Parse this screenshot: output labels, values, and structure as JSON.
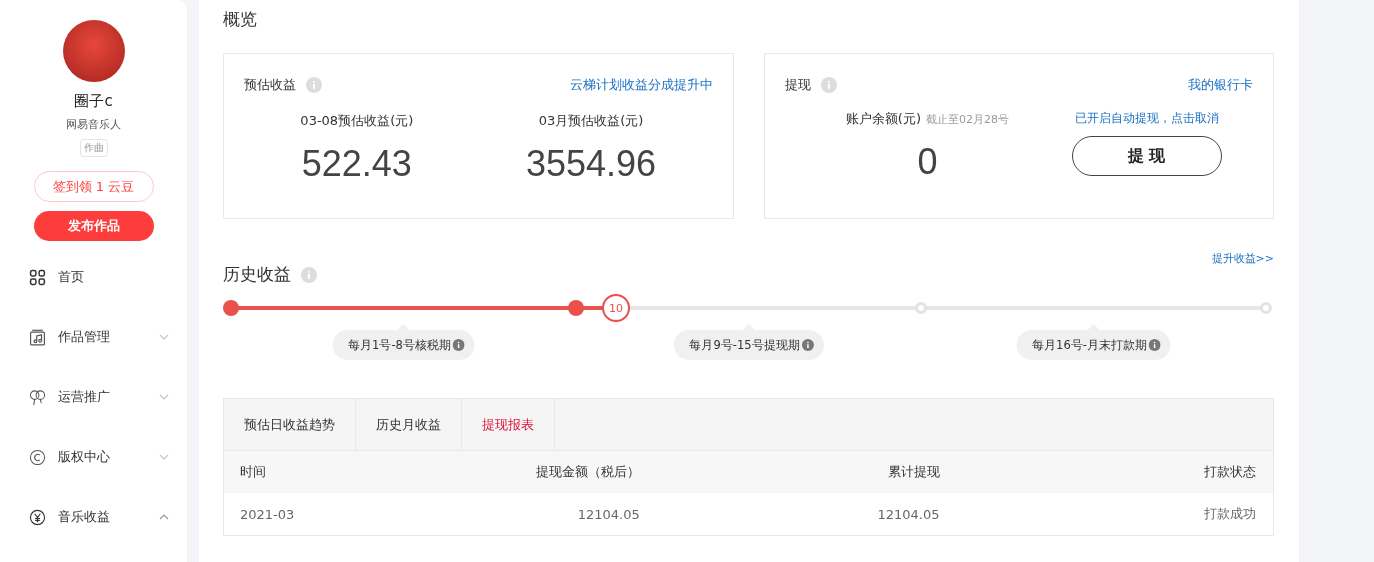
{
  "profile": {
    "name": "圈子c",
    "role": "网易音乐人",
    "tag": "作曲"
  },
  "sidebar": {
    "checkin_button": "签到领 1 云豆",
    "publish_button": "发布作品",
    "items": [
      {
        "label": "首页",
        "kind": "plain"
      },
      {
        "label": "作品管理",
        "kind": "group",
        "expanded": false
      },
      {
        "label": "运营推广",
        "kind": "group",
        "expanded": false
      },
      {
        "label": "版权中心",
        "kind": "group",
        "expanded": false
      },
      {
        "label": "音乐收益",
        "kind": "group",
        "expanded": true
      }
    ]
  },
  "overview": {
    "title": "概览",
    "earnings": {
      "title": "预估收益",
      "link": "云梯计划收益分成提升中",
      "stats": [
        {
          "label": "03-08预估收益(元)",
          "value": "522.43"
        },
        {
          "label": "03月预估收益(元)",
          "value": "3554.96"
        }
      ]
    },
    "withdraw": {
      "title": "提现",
      "link": "我的银行卡",
      "balance_label": "账户余额(元)",
      "balance_note": "截止至02月28号",
      "balance": "0",
      "auto_note": "已开启自动提现，点击取消",
      "button": "提 现"
    }
  },
  "history": {
    "title": "历史收益",
    "link": "提升收益>>",
    "timeline": {
      "level": 0.372,
      "marker": "10",
      "nodes": [
        {
          "reached": true
        },
        {
          "reached": true
        },
        {
          "reached": false
        },
        {
          "reached": false
        }
      ],
      "periods": [
        "每月1号-8号核税期",
        "每月9号-15号提现期",
        "每月16号-月末打款期"
      ]
    }
  },
  "tabs": [
    {
      "label": "预估日收益趋势",
      "selected": false
    },
    {
      "label": "历史月收益",
      "selected": false
    },
    {
      "label": "提现报表",
      "selected": true
    }
  ],
  "table": {
    "columns": [
      "时间",
      "提现金额（税后）",
      "累计提现",
      "打款状态"
    ],
    "rows": [
      [
        "2021-03",
        "12104.05",
        "12104.05",
        "打款成功"
      ]
    ]
  }
}
